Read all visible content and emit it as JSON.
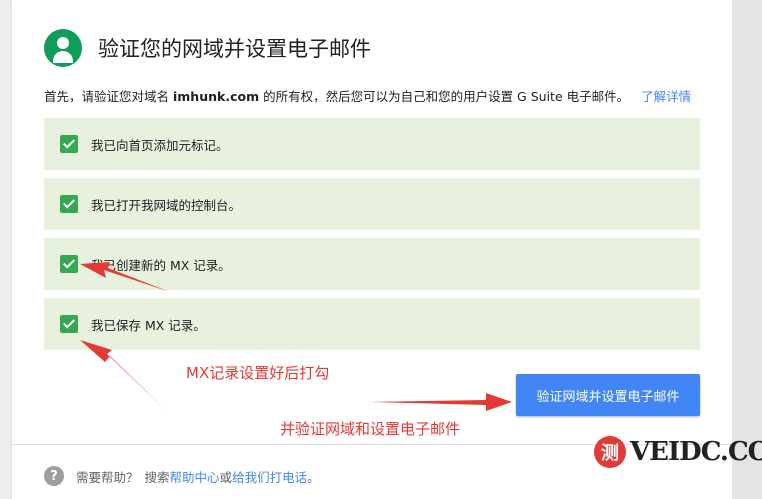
{
  "header": {
    "title": "验证您的网域并设置电子邮件",
    "icon": "account-circle-icon"
  },
  "intro": {
    "prefix": "首先，请验证您对域名",
    "domain": "imhunk.com",
    "suffix": "的所有权，然后您可以为自己和您的用户设置 G Suite 电子邮件。",
    "link": "了解详情"
  },
  "checklist": [
    {
      "label": "我已向首页添加元标记。",
      "checked": true
    },
    {
      "label": "我已打开我网域的控制台。",
      "checked": true
    },
    {
      "label": "我已创建新的 MX 记录。",
      "checked": true
    },
    {
      "label": "我已保存 MX 记录。",
      "checked": true
    }
  ],
  "primary_button": "验证网域并设置电子邮件",
  "footer": {
    "need_help": "需要帮助？",
    "search": "搜索",
    "help_center": "帮助中心",
    "or": "或",
    "call_us": "给我们打电话",
    "end": "。"
  },
  "annotations": {
    "mx_note": "MX记录设置好后打勾",
    "verify_note": "并验证网域和设置电子邮件"
  },
  "watermark": {
    "badge": "测",
    "text": "VEIDC.COM"
  },
  "colors": {
    "accent": "#4285f4",
    "check": "#34a853",
    "item_bg": "#e8f0de",
    "annotation": "#e53935",
    "avatar": "#0f9d58"
  }
}
